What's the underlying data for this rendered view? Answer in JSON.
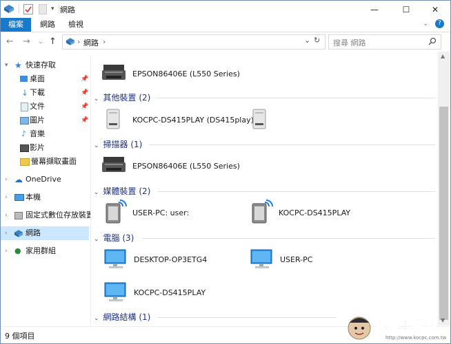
{
  "titlebar": {
    "title": "網路",
    "min_glyph": "—",
    "max_glyph": "☐",
    "close_glyph": "✕"
  },
  "ribbon": {
    "tabs": [
      "檔案",
      "網路",
      "檢視"
    ],
    "help_glyph": "?"
  },
  "address": {
    "path_sep": "›",
    "location": "網路",
    "dropdown_glyph": "⌄",
    "refresh_glyph": "↻",
    "search_placeholder": "搜尋 網路"
  },
  "nav": {
    "quick_access": "快速存取",
    "quick_items": [
      "桌面",
      "下載",
      "文件",
      "圖片",
      "音樂",
      "影片",
      "螢幕擷取畫面"
    ],
    "onedrive": "OneDrive",
    "this_pc": "本機",
    "removable": "固定式數位存放裝置",
    "network": "網路",
    "homegroup": "家用群組"
  },
  "groups": {
    "other": "其他裝置 (2)",
    "scanner": "掃描器 (1)",
    "media": "媒體裝置 (2)",
    "computer": "電腦 (3)",
    "infra": "網路結構 (1)"
  },
  "devices": {
    "printer_top": "EPSON86406E (L550 Series)",
    "other_1": "KOCPC-DS415PLAY (DS415play)",
    "scanner_1": "EPSON86406E (L550 Series)",
    "media_1": "USER-PC: user:",
    "media_2": "KOCPC-DS415PLAY",
    "pc_1": "DESKTOP-OP3ETG4",
    "pc_2": "USER-PC",
    "pc_3": "KOCPC-DS415PLAY"
  },
  "status": {
    "count": "9 個項目"
  },
  "watermark": {
    "text": "電腦王阿達",
    "url": "http://www.kocpc.com.tw"
  },
  "colors": {
    "accent": "#1979ca",
    "group_title": "#1e3287",
    "selection": "#cce8ff"
  }
}
